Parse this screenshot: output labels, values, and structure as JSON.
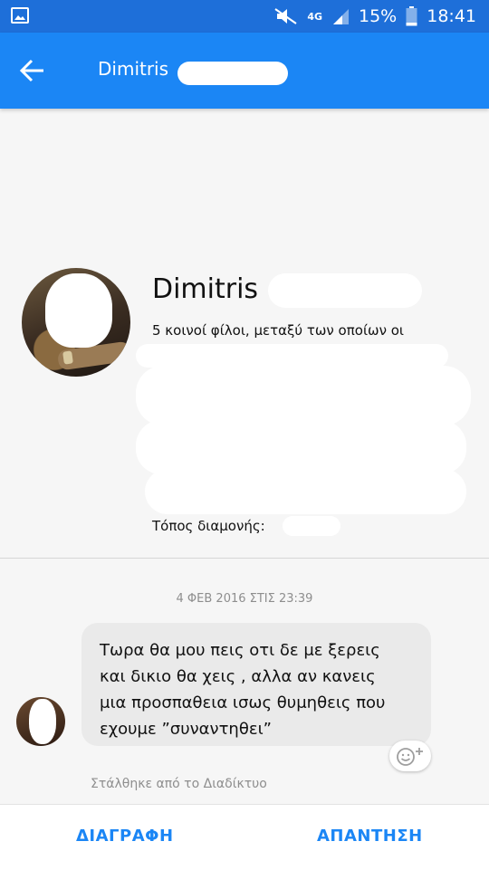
{
  "status_bar": {
    "network": "4G",
    "battery": "15%",
    "time": "18:41",
    "icons": [
      "gallery-icon",
      "mute-icon",
      "signal-icon",
      "battery-icon"
    ]
  },
  "header": {
    "title": "Dimitris",
    "back_icon": "back-arrow-icon"
  },
  "profile": {
    "name": "Dimitris",
    "mutual_friends": "5 κοινοί φίλοι, μεταξύ των οποίων οι",
    "residence_label": "Τόπος διαμονής:"
  },
  "conversation": {
    "date": "4 ΦΕΒ 2016 ΣΤΙΣ 23:39",
    "message_lines": [
      "Τωρα θα μου πεις οτι δε με ξερεις",
      "και δικιο θα χεις , αλλα αν κανεις",
      "μια προσπαθεια ισως θυμηθεις που",
      "εχουμε ”συναντηθει”"
    ],
    "sent_from": "Στάλθηκε από το Διαδίκτυο"
  },
  "actions": {
    "delete_label": "ΔΙΑΓΡΑΦΗ",
    "reply_label": "ΑΠΑΝΤΗΣΗ"
  },
  "colors": {
    "status_bar": "#1e6fd9",
    "app_bar": "#1b86f5",
    "accent": "#1b86f5",
    "bubble": "#eaeaea"
  }
}
